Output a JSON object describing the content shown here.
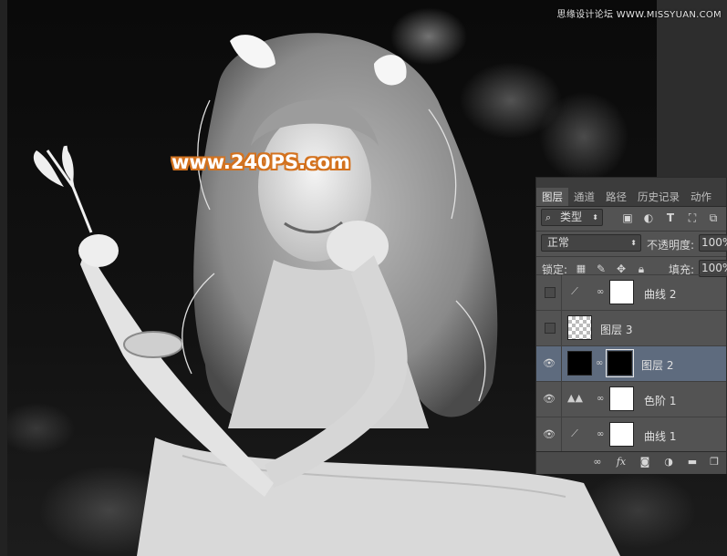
{
  "watermarks": {
    "top": "思缘设计论坛 WWW.MISSYUAN.COM",
    "main": "www.240PS.com"
  },
  "layers_panel": {
    "tabs": [
      "图层",
      "通道",
      "路径",
      "历史记录",
      "动作"
    ],
    "active_tab": "图层",
    "filter": {
      "label": "类型",
      "icons": [
        "image-filter-icon",
        "adjustment-filter-icon",
        "text-filter-icon",
        "shape-filter-icon",
        "smart-object-filter-icon"
      ]
    },
    "blend_mode": "正常",
    "opacity": {
      "label": "不透明度:",
      "value": "100%"
    },
    "lock": {
      "label": "锁定:"
    },
    "fill": {
      "label": "填充:",
      "value": "100%"
    },
    "layers": [
      {
        "name": "曲线 2",
        "type": "curves-adjustment",
        "visible": false,
        "selected": false
      },
      {
        "name": "图层 3",
        "type": "pixel",
        "visible": false,
        "selected": false
      },
      {
        "name": "图层 2",
        "type": "pixel-with-mask",
        "visible": true,
        "selected": true
      },
      {
        "name": "色阶 1",
        "type": "levels-adjustment",
        "visible": true,
        "selected": false
      },
      {
        "name": "曲线 1",
        "type": "curves-adjustment",
        "visible": true,
        "selected": false
      }
    ],
    "bottom_icons": [
      "link-icon",
      "fx-icon",
      "mask-icon",
      "adjustment-icon",
      "group-folder-icon",
      "new-layer-icon"
    ],
    "colors": {
      "panel_bg": "#535353",
      "selected_row": "#5e6b7e"
    }
  }
}
